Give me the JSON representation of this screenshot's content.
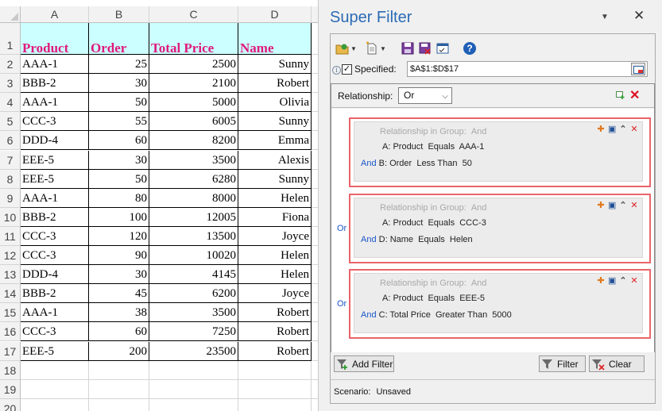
{
  "spreadsheet": {
    "columns": [
      "A",
      "B",
      "C",
      "D"
    ],
    "row_numbers": [
      "1",
      "2",
      "3",
      "4",
      "5",
      "6",
      "7",
      "8",
      "9",
      "10",
      "11",
      "12",
      "13",
      "14",
      "15",
      "16",
      "17",
      "18",
      "19",
      "20"
    ],
    "headers": [
      "Product",
      "Order",
      "Total Price",
      "Name"
    ],
    "rows": [
      [
        "AAA-1",
        "25",
        "2500",
        "Sunny"
      ],
      [
        "BBB-2",
        "30",
        "2100",
        "Robert"
      ],
      [
        "AAA-1",
        "50",
        "5000",
        "Olivia"
      ],
      [
        "CCC-3",
        "55",
        "6005",
        "Sunny"
      ],
      [
        "DDD-4",
        "60",
        "8200",
        "Emma"
      ],
      [
        "EEE-5",
        "30",
        "3500",
        "Alexis"
      ],
      [
        "EEE-5",
        "50",
        "6280",
        "Sunny"
      ],
      [
        "AAA-1",
        "80",
        "8000",
        "Helen"
      ],
      [
        "BBB-2",
        "100",
        "12005",
        "Fiona"
      ],
      [
        "CCC-3",
        "120",
        "13500",
        "Joyce"
      ],
      [
        "CCC-3",
        "90",
        "10020",
        "Helen"
      ],
      [
        "DDD-4",
        "30",
        "4145",
        "Helen"
      ],
      [
        "BBB-2",
        "45",
        "6200",
        "Joyce"
      ],
      [
        "AAA-1",
        "38",
        "3500",
        "Robert"
      ],
      [
        "CCC-3",
        "60",
        "7250",
        "Robert"
      ],
      [
        "EEE-5",
        "200",
        "23500",
        "Robert"
      ]
    ]
  },
  "pane": {
    "title": "Super Filter",
    "menu_icon": "chevron-down-icon",
    "close_glyph": "✕",
    "specified_label": "Specified:",
    "specified_checked": true,
    "range_value": "$A$1:$D$17",
    "relationship_label": "Relationship:",
    "relationship_value": "Or",
    "groups": [
      {
        "title_label": "Relationship in Group:",
        "title_value": "And",
        "or_label": "",
        "cond1": "A: Product  Equals  AAA-1",
        "cond2_and": "And",
        "cond2": "B: Order  Less Than  50"
      },
      {
        "title_label": "Relationship in Group:",
        "title_value": "And",
        "or_label": "Or",
        "cond1": "A: Product  Equals  CCC-3",
        "cond2_and": "And",
        "cond2": "D: Name  Equals  Helen"
      },
      {
        "title_label": "Relationship in Group:",
        "title_value": "And",
        "or_label": "Or",
        "cond1": "A: Product  Equals  EEE-5",
        "cond2_and": "And",
        "cond2": "C: Total Price  Greater Than  5000"
      }
    ],
    "add_filter_label": "Add Filter",
    "filter_label": "Filter",
    "clear_label": "Clear",
    "scenario_label": "Scenario:",
    "scenario_value": "Unsaved",
    "colors": {
      "title": "#2b6bb5",
      "header_fill": "#ccffff",
      "header_text": "#e0197d",
      "group_border": "#e9656a",
      "and_text": "#1a55c8"
    }
  }
}
